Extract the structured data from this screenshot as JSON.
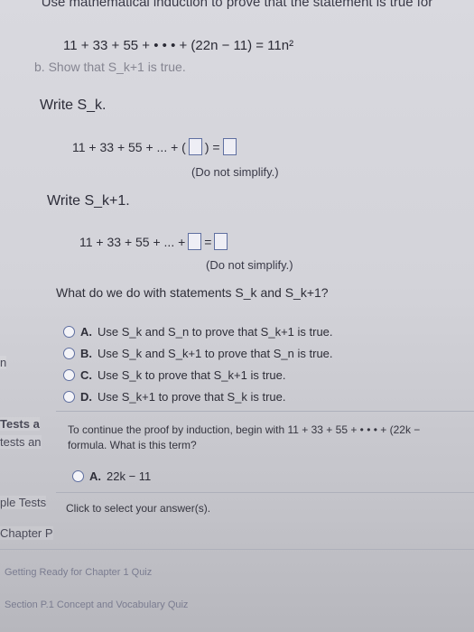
{
  "header": {
    "title_line": "Use mathematical induction to prove that the statement is true for"
  },
  "statement": {
    "equation": "11 + 33 + 55 + • • • + (22n − 11) = 11n²"
  },
  "step_b": {
    "text": "b. Show that S_k+1 is true."
  },
  "write_sk": {
    "label": "Write S_k.",
    "lhs": "11 + 33 + 55 + ... + (",
    "mid": ") =",
    "note": "(Do not simplify.)"
  },
  "write_sk1": {
    "label": "Write S_k+1.",
    "lhs": "11 + 33 + 55 + ... +",
    "mid": "=",
    "note": "(Do not simplify.)"
  },
  "question": {
    "text": "What do we do with statements S_k and S_k+1?"
  },
  "options": [
    {
      "letter": "A.",
      "text": "Use S_k and S_n to prove that S_k+1 is true."
    },
    {
      "letter": "B.",
      "text": "Use S_k and S_k+1 to prove that S_n is true."
    },
    {
      "letter": "C.",
      "text": "Use S_k to prove that S_k+1 is true."
    },
    {
      "letter": "D.",
      "text": "Use S_k+1 to prove that S_k is true."
    }
  ],
  "sidebar": {
    "items": [
      {
        "label": "n"
      },
      {
        "label": "Tests a"
      },
      {
        "label": "tests an"
      },
      {
        "label": "ple Tests"
      },
      {
        "label": "Chapter P"
      }
    ]
  },
  "continue_panel": {
    "text_line1": "To continue the proof by induction, begin with 11 + 33 + 55 + • • • + (22k −",
    "text_line2": "formula. What is this term?",
    "option": {
      "letter": "A.",
      "text": "22k − 11"
    },
    "status": "Click to select your answer(s)."
  },
  "quiz_links": [
    {
      "label": "Getting Ready for Chapter 1 Quiz"
    },
    {
      "label": "Section P.1 Concept and Vocabulary Quiz"
    }
  ]
}
